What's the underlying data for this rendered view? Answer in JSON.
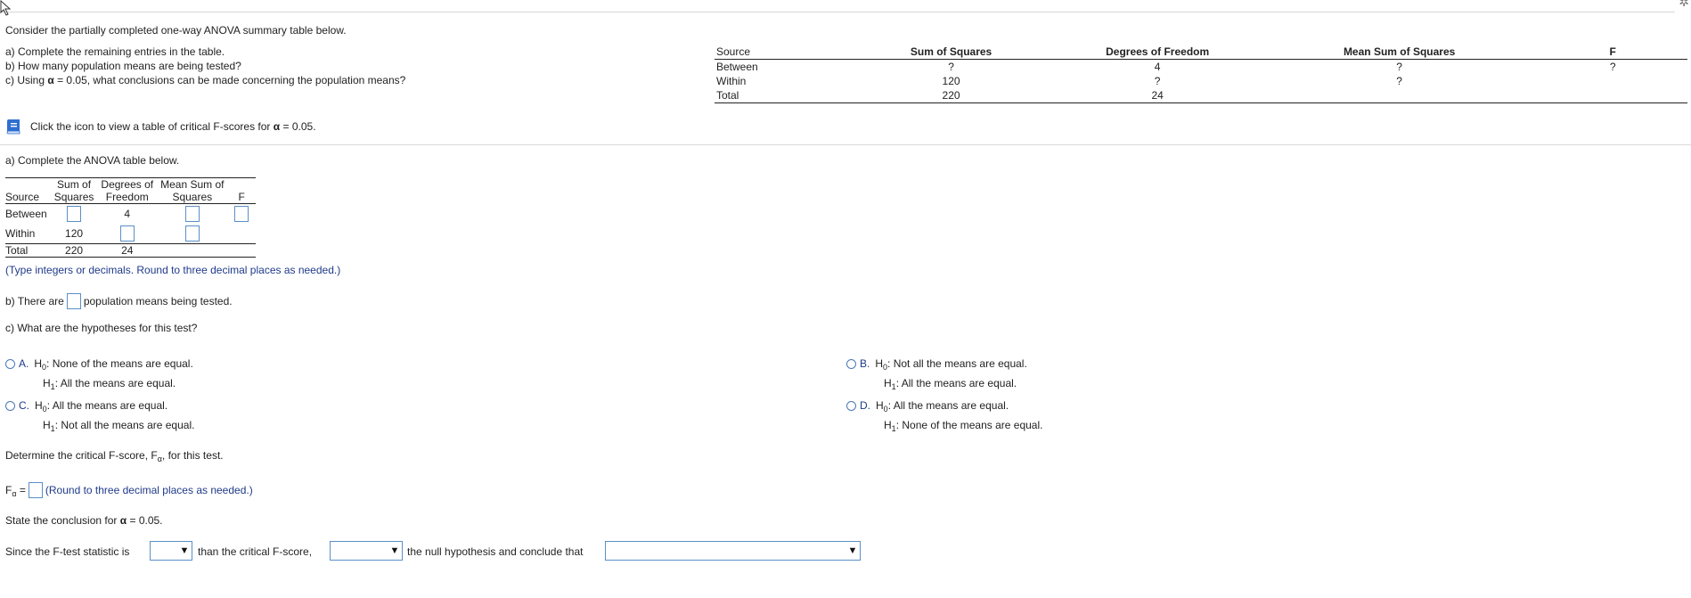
{
  "intro": "Consider the partially completed one-way ANOVA summary table below.",
  "parts": {
    "a": "a) Complete the remaining entries in the table.",
    "b": "b) How many population means are being tested?",
    "c_prefix": "c) Using ",
    "c_alpha": "α",
    "c_suffix": " = 0.05, what conclusions can be made concerning the population means?"
  },
  "ref_table": {
    "headers": [
      "Source",
      "Sum of Squares",
      "Degrees of Freedom",
      "Mean Sum of Squares",
      "F"
    ],
    "rows": [
      [
        "Between",
        "?",
        "4",
        "?",
        "?"
      ],
      [
        "Within",
        "120",
        "?",
        "?",
        ""
      ],
      [
        "Total",
        "220",
        "24",
        "",
        ""
      ]
    ]
  },
  "icon_line": {
    "text": "Click the icon to view a table of critical F-scores for ",
    "alpha": "α",
    "suffix": " = 0.05."
  },
  "section_a": {
    "title": "a) Complete the ANOVA table below.",
    "headers": {
      "source": "Source",
      "ss_1": "Sum of",
      "ss_2": "Squares",
      "df_1": "Degrees of",
      "df_2": "Freedom",
      "ms_1": "Mean Sum of",
      "ms_2": "Squares",
      "f": "F"
    },
    "rows": {
      "between_label": "Between",
      "between_df": "4",
      "within_label": "Within",
      "within_ss": "120",
      "total_label": "Total",
      "total_ss": "220",
      "total_df": "24"
    },
    "note": "(Type integers or decimals. Round to three decimal places as needed.)"
  },
  "section_b": {
    "prefix": "b) There are",
    "suffix": "population means being tested."
  },
  "section_c": {
    "question": "c) What are the hypotheses for this test?",
    "options": [
      {
        "letter": "A.",
        "h0": "None of the means are equal.",
        "h1": "All the means are equal."
      },
      {
        "letter": "B.",
        "h0": "Not all the means are equal.",
        "h1": "All the means are equal."
      },
      {
        "letter": "C.",
        "h0": "All the means are equal.",
        "h1": "Not all the means are equal."
      },
      {
        "letter": "D.",
        "h0": "All the means are equal.",
        "h1": "None of the means are equal."
      }
    ],
    "h0_label": "H",
    "h0_sub": "0",
    "h1_label": "H",
    "h1_sub": "1"
  },
  "critical": {
    "text_prefix": "Determine the critical F-score, F",
    "text_sub": "α",
    "text_suffix": ", for this test.",
    "fa_label": "F",
    "fa_sub": "α",
    "fa_eq": " =",
    "round_note": "(Round to three decimal places as needed.)"
  },
  "conclusion": {
    "state_prefix": "State the conclusion for ",
    "state_alpha": "α",
    "state_suffix": " = 0.05.",
    "since": "Since the F-test statistic is",
    "than": "than the critical F-score,",
    "null": "the null hypothesis and conclude that"
  }
}
